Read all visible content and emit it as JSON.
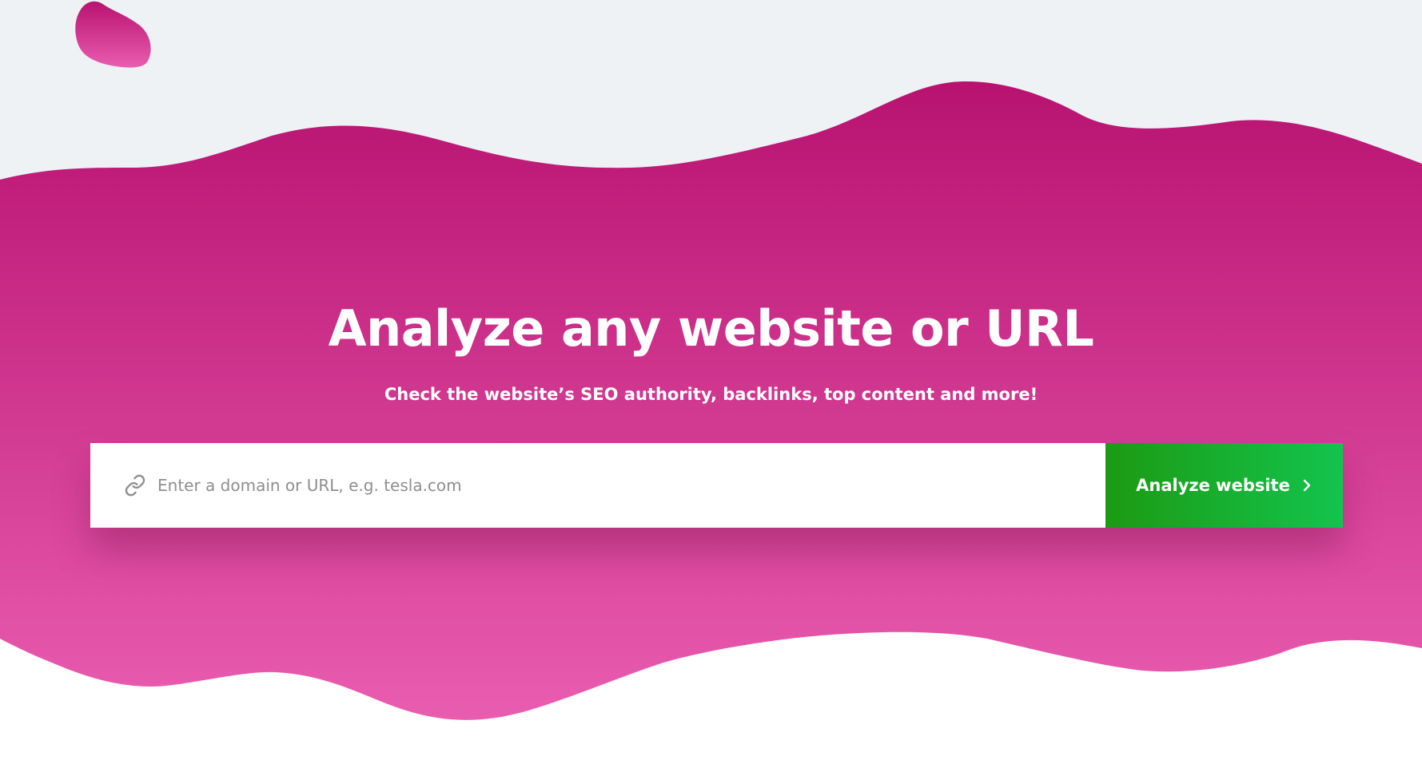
{
  "hero": {
    "title": "Analyze any website or URL",
    "subtitle": "Check the website’s SEO authority, backlinks, top content and more!"
  },
  "search": {
    "placeholder": "Enter a domain or URL, e.g. tesla.com",
    "value": "",
    "icon": "link-icon",
    "button_label": "Analyze website",
    "button_icon": "chevron-right-icon"
  },
  "colors": {
    "background_top": "#eef2f5",
    "hero_gradient_top": "#b81270",
    "hero_gradient_bottom": "#e95db0",
    "button_gradient_start": "#1c9a13",
    "button_gradient_end": "#13c44d",
    "placeholder_text": "#8e8e8e"
  }
}
